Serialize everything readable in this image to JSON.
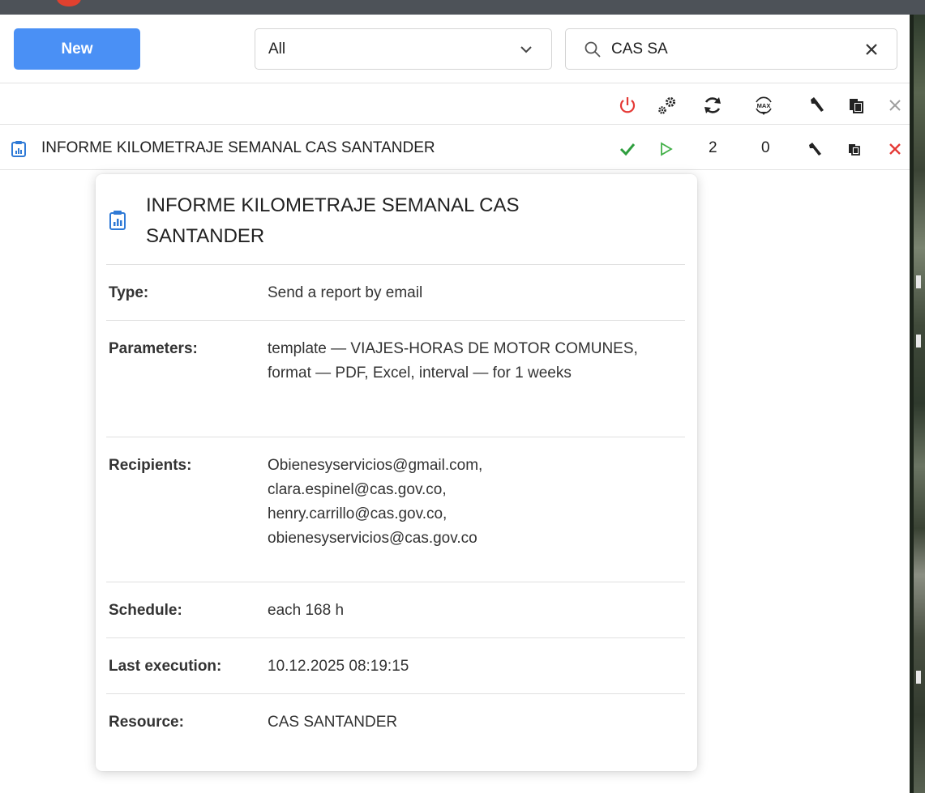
{
  "toolbar": {
    "new_label": "New",
    "filter_value": "All",
    "search_value": "CAS SA"
  },
  "header_icons": [
    "power-icon",
    "gears-icon",
    "refresh-icon",
    "max-icon",
    "wrench-icon",
    "copy-icon",
    "close-icon"
  ],
  "list": {
    "items": [
      {
        "title": "INFORME KILOMETRAJE SEMANAL CAS SANTANDER",
        "count1": "2",
        "count2": "0"
      }
    ]
  },
  "tooltip": {
    "title": "INFORME KILOMETRAJE SEMANAL CAS SANTANDER",
    "rows": [
      {
        "label": "Type:",
        "value": "Send a report by email"
      },
      {
        "label": "Parameters:",
        "value": "template — VIAJES-HORAS DE MOTOR COMUNES, format — PDF, Excel, interval — for 1 weeks"
      },
      {
        "label": "Recipients:",
        "value": "Obienesyservicios@gmail.com, clara.espinel@cas.gov.co, henry.carrillo@cas.gov.co, obienesyservicios@cas.gov.co"
      },
      {
        "label": "Schedule:",
        "value": "each 168 h"
      },
      {
        "label": "Last execution:",
        "value": "10.12.2025 08:19:15"
      },
      {
        "label": "Resource:",
        "value": "CAS SANTANDER"
      }
    ]
  },
  "colors": {
    "accent": "#4a90f5",
    "power_red": "#e53935",
    "check_green": "#2e9e3e",
    "play_green": "#43b049",
    "delete_red": "#e53935",
    "report_icon_blue": "#2f7ad6"
  }
}
